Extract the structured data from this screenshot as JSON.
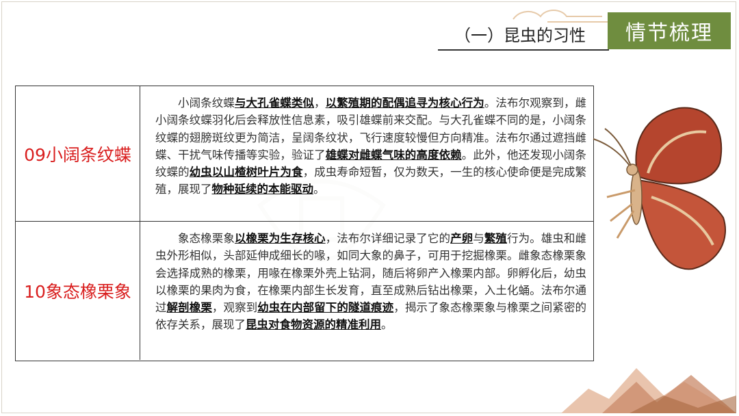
{
  "header": {
    "section_tab": "情节梳理",
    "subtitle": "（一）昆虫的习性"
  },
  "rows": [
    {
      "label": "09小阔条纹蝶",
      "segments": [
        {
          "t": "小阔条纹蝶",
          "b": false
        },
        {
          "t": "与大孔雀蝶类似",
          "b": true
        },
        {
          "t": "，",
          "b": false
        },
        {
          "t": "以繁殖期的配偶追寻为核心行为",
          "b": true
        },
        {
          "t": "。法布尔观察到，雌小阔条纹蝶羽化后会释放性信息素，吸引雄蝶前来交配。与大孔雀蝶不同的是，小阔条纹蝶的翅膀斑纹更为简洁，呈阔条纹状，飞行速度较慢但方向精准。法布尔通过遮挡雌蝶、干扰气味传播等实验，验证了",
          "b": false
        },
        {
          "t": "雄蝶对雌蝶气味的高度依赖",
          "b": true
        },
        {
          "t": "。此外，他还发现小阔条纹蝶的",
          "b": false
        },
        {
          "t": "幼虫以山楂树叶片为食",
          "b": true
        },
        {
          "t": "，成虫寿命短暂，仅为数天，一生的核心使命便是完成繁殖，展现了",
          "b": false
        },
        {
          "t": "物种延续的本能驱动",
          "b": true
        },
        {
          "t": "。",
          "b": false
        }
      ]
    },
    {
      "label": "10象态橡栗象",
      "segments": [
        {
          "t": "象态橡栗象",
          "b": false
        },
        {
          "t": "以橡栗为生存核心",
          "b": true
        },
        {
          "t": "，法布尔详细记录了它的",
          "b": false
        },
        {
          "t": "产卵",
          "b": true
        },
        {
          "t": "与",
          "b": false
        },
        {
          "t": "繁殖",
          "b": true
        },
        {
          "t": "行为。雄虫和雌虫外形相似，头部延伸成细长的喙，如同大象的鼻子，可用于挖掘橡栗。雌象态橡栗象会选择成熟的橡栗，用喙在橡栗外壳上钻洞，随后将卵产入橡栗内部。卵孵化后，幼虫以橡栗的果肉为食，在橡栗内部生长发育，直至成熟后钻出橡栗，入土化蛹。法布尔通过",
          "b": false
        },
        {
          "t": "解剖橡栗",
          "b": true
        },
        {
          "t": "，观察到",
          "b": false
        },
        {
          "t": "幼虫在内部留下的隧道痕迹",
          "b": true
        },
        {
          "t": "，揭示了象态橡栗象与橡栗之间紧密的依存关系，展现了",
          "b": false
        },
        {
          "t": "昆虫对食物资源的精准利用",
          "b": true
        },
        {
          "t": "。",
          "b": false
        }
      ]
    }
  ],
  "colors": {
    "tab_bg": "#6f8d3f",
    "label_red": "#d91e1e",
    "butterfly_wing": "#b5452e",
    "mountain_tint": "#c98a6a"
  }
}
